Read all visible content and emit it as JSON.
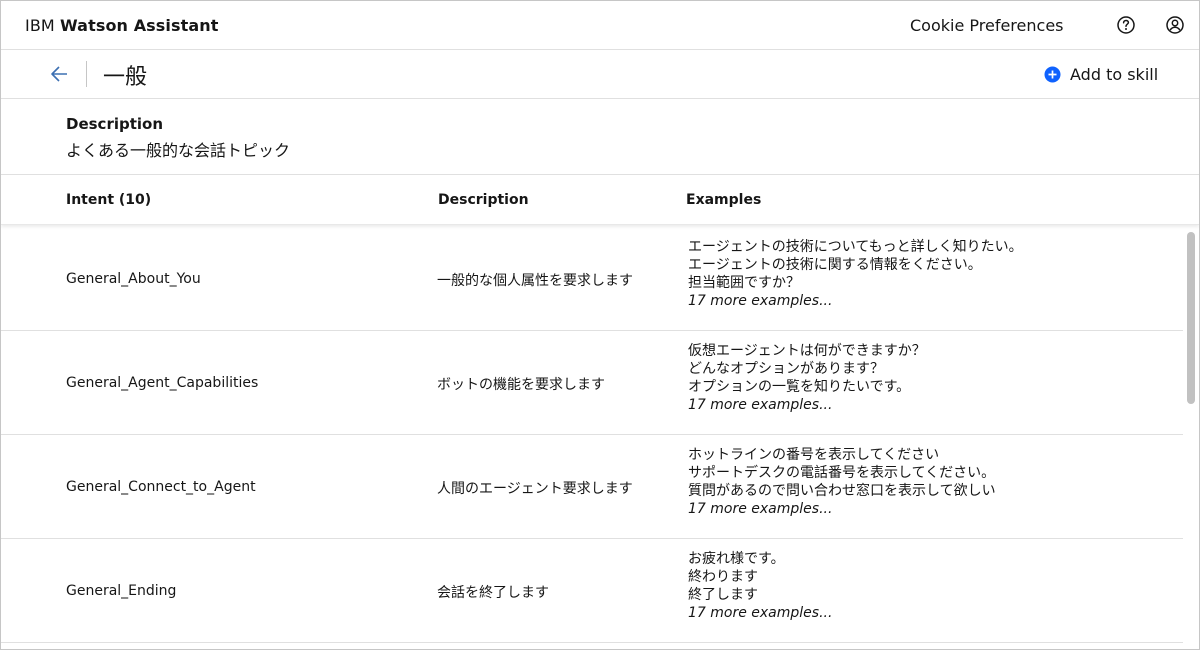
{
  "header": {
    "brand_prefix": "IBM",
    "brand_name": "Watson Assistant",
    "cookie_link": "Cookie Preferences",
    "help_icon": "help-circle-icon",
    "user_icon": "user-avatar-icon"
  },
  "titlebar": {
    "back_icon": "arrow-left-icon",
    "title": "一般",
    "add_button_label": "Add to skill",
    "add_icon": "add-filled-icon",
    "accent_color": "#0f62fe"
  },
  "description": {
    "heading": "Description",
    "text": "よくある一般的な会話トピック"
  },
  "table": {
    "columns": {
      "intent": "Intent (10)",
      "description": "Description",
      "examples": "Examples"
    },
    "rows": [
      {
        "intent": "General_About_You",
        "description": "一般的な個人属性を要求します",
        "examples": [
          "エージェントの技術についてもっと詳しく知りたい。",
          "エージェントの技術に関する情報をください。",
          "担当範囲ですか？"
        ],
        "more": "17 more examples..."
      },
      {
        "intent": "General_Agent_Capabilities",
        "description": "ボットの機能を要求します",
        "examples": [
          "仮想エージェントは何ができますか？",
          "どんなオプションがあります？",
          "オプションの一覧を知りたいです。"
        ],
        "more": "17 more examples..."
      },
      {
        "intent": "General_Connect_to_Agent",
        "description": "人間のエージェント要求します",
        "examples": [
          "ホットラインの番号を表示してください",
          "サポートデスクの電話番号を表示してください。",
          "質問があるので問い合わせ窓口を表示して欲しい"
        ],
        "more": "17 more examples..."
      },
      {
        "intent": "General_Ending",
        "description": "会話を終了します",
        "examples": [
          "お疲れ様です。",
          "終わります",
          "終了します"
        ],
        "more": "17 more examples..."
      }
    ]
  }
}
